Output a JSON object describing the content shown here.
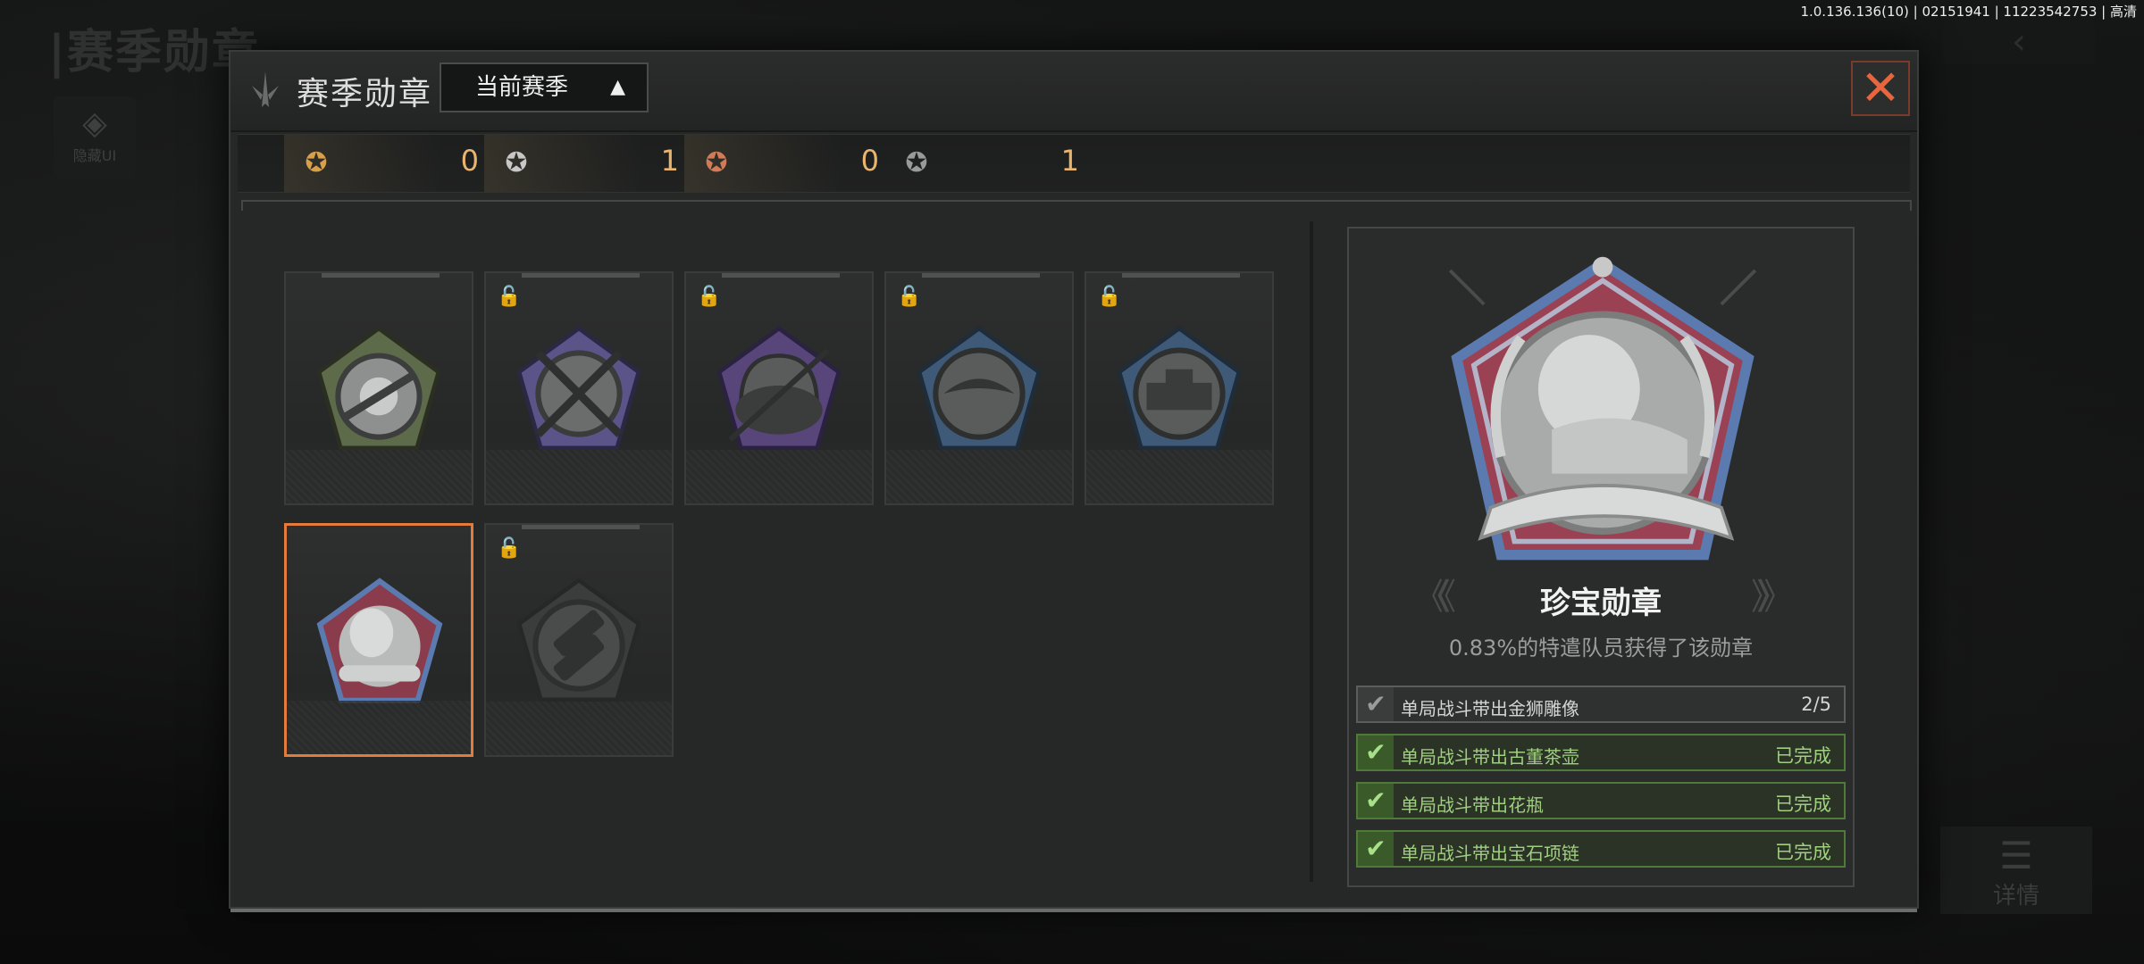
{
  "background": {
    "title": "|赛季勋章",
    "hide_ui_label": "隐藏UI",
    "back_icon": "back-arrow-icon",
    "detail_label": "详情"
  },
  "version": "1.0.136.136(10) | 02151941 | 11223542753 | 高清",
  "modal": {
    "title": "赛季勋章",
    "season_select": "当前赛季",
    "close_icon": "close-icon"
  },
  "counts": [
    {
      "icon": "gold-medal-icon",
      "color": "#d9a04a",
      "value": "0"
    },
    {
      "icon": "silver-medal-icon",
      "color": "#c8c8c8",
      "value": "1"
    },
    {
      "icon": "bronze-medal-icon",
      "color": "#d17b58",
      "value": "0"
    },
    {
      "icon": "gray-medal-icon",
      "color": "#9a9a9a",
      "value": "1"
    }
  ],
  "medals": [
    {
      "name": "sniper-medal",
      "locked": false,
      "selected": false,
      "tint": "#5e6b4a"
    },
    {
      "name": "crossed-rifles-medal",
      "locked": true,
      "selected": false,
      "tint": "#5b5488"
    },
    {
      "name": "helmet-medal",
      "locked": true,
      "selected": false,
      "tint": "#58457a"
    },
    {
      "name": "eagle-medal",
      "locked": true,
      "selected": false,
      "tint": "#3f5a78"
    },
    {
      "name": "tank-medal",
      "locked": true,
      "selected": false,
      "tint": "#3f5a78"
    },
    {
      "name": "treasure-medal",
      "locked": false,
      "selected": true,
      "tint": "#8a3c4c"
    },
    {
      "name": "dark-medal",
      "locked": true,
      "selected": false,
      "tint": "#3b3c3c"
    }
  ],
  "detail": {
    "name": "珍宝勋章",
    "description": "0.83%的特遣队员获得了该勋章",
    "tasks": [
      {
        "text": "单局战斗带出金狮雕像",
        "status": "2/5",
        "done": false
      },
      {
        "text": "单局战斗带出古董茶壶",
        "status": "已完成",
        "done": true
      },
      {
        "text": "单局战斗带出花瓶",
        "status": "已完成",
        "done": true
      },
      {
        "text": "单局战斗带出宝石项链",
        "status": "已完成",
        "done": true
      }
    ]
  }
}
